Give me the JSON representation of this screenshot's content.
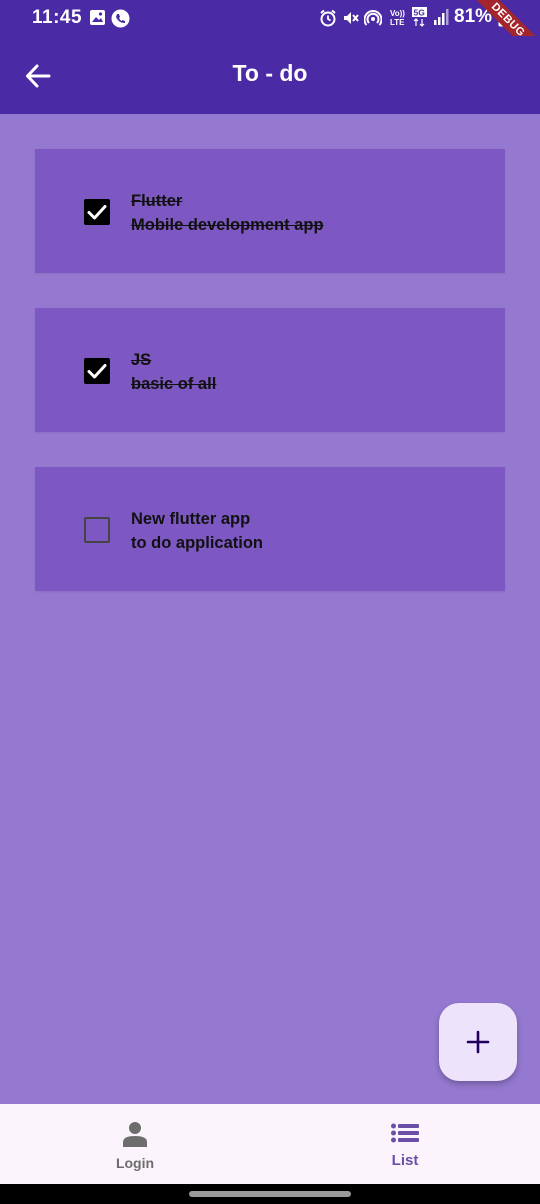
{
  "status_bar": {
    "time": "11:45",
    "battery": "81%",
    "left_icons": [
      "image-icon",
      "phone-call-icon"
    ],
    "right_icons": [
      "alarm-icon",
      "mute-icon",
      "hotspot-icon",
      "volte-icon",
      "5g-icon",
      "signal-icon",
      "battery-icon"
    ],
    "volte_label": "Vo)) LTE",
    "network_label": "5G"
  },
  "debug_banner": "DEBUG",
  "app_bar": {
    "title": "To - do",
    "back_icon": "arrow-left-icon"
  },
  "tasks": [
    {
      "title": "Flutter",
      "subtitle": "Mobile development app",
      "checked": true
    },
    {
      "title": "JS",
      "subtitle": "basic of all",
      "checked": true
    },
    {
      "title": "New flutter app",
      "subtitle": "to do application",
      "checked": false
    }
  ],
  "fab": {
    "icon": "plus-icon"
  },
  "bottom_nav": {
    "items": [
      {
        "label": "Login",
        "icon": "person-icon",
        "active": false
      },
      {
        "label": "List",
        "icon": "list-icon",
        "active": true
      }
    ]
  },
  "colors": {
    "app_bar": "#4b2aa6",
    "background": "#9578cf",
    "card": "#7d58c2",
    "fab": "#ede3fb",
    "nav_bar": "#fcf4fc",
    "nav_active": "#6a4fa6"
  }
}
